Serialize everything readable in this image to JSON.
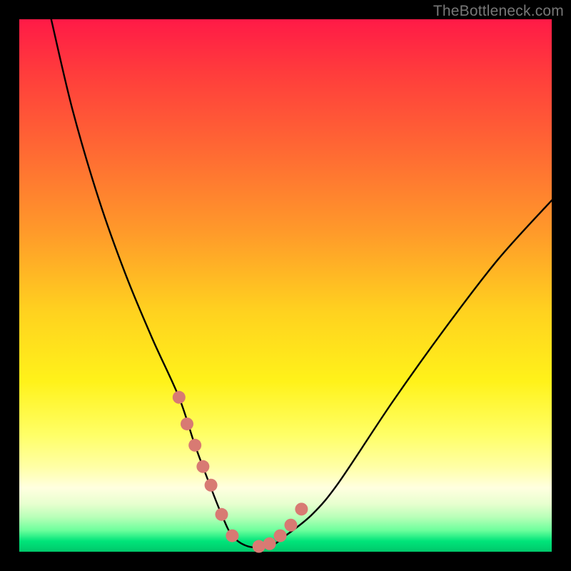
{
  "watermark": {
    "text": "TheBottleneck.com"
  },
  "colors": {
    "frame_bg": "#000000",
    "curve_stroke": "#000000",
    "marker_fill": "#d87a73",
    "watermark_color": "#777777",
    "gradient_stops": [
      "#ff1a47",
      "#ff3c3c",
      "#ff6a33",
      "#ff9a2a",
      "#ffd21f",
      "#fff21a",
      "#ffff66",
      "#ffffa5",
      "#ffffe0",
      "#e8ffcf",
      "#b8ffb8",
      "#6cff9c",
      "#00e47a",
      "#00c86b"
    ]
  },
  "chart_data": {
    "type": "line",
    "title": "",
    "xlabel": "",
    "ylabel": "",
    "xlim": [
      0,
      100
    ],
    "ylim": [
      0,
      100
    ],
    "grid": false,
    "legend": false,
    "series": [
      {
        "name": "bottleneck-curve",
        "x": [
          6,
          10,
          15,
          20,
          25,
          30,
          33,
          36,
          38,
          40,
          43,
          47,
          50,
          55,
          60,
          70,
          80,
          90,
          100
        ],
        "values": [
          100,
          83,
          66,
          52,
          40,
          29,
          20,
          12,
          7,
          3,
          1,
          1,
          3,
          7,
          13,
          28,
          42,
          55,
          66
        ]
      }
    ],
    "markers": {
      "name": "highlight-points",
      "x": [
        30.0,
        31.5,
        33.0,
        34.5,
        36.0,
        38.0,
        40.0,
        45.0,
        47.0,
        49.0,
        51.0,
        53.0
      ],
      "values": [
        29.0,
        24.0,
        20.0,
        16.0,
        12.5,
        7.0,
        3.0,
        1.0,
        1.5,
        3.0,
        5.0,
        8.0
      ]
    }
  }
}
